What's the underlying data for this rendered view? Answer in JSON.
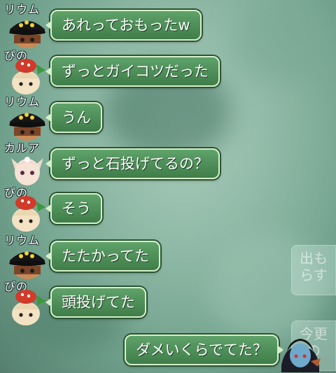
{
  "chat": {
    "messages": [
      {
        "speaker": "リウム",
        "text": "あれっておもったw"
      },
      {
        "speaker": "ぴの",
        "text": "ずっとガイコツだった"
      },
      {
        "speaker": "リウム",
        "text": "うん"
      },
      {
        "speaker": "カルア",
        "text": "ずっと石投げてるの？"
      },
      {
        "speaker": "ぴの",
        "text": "そう"
      },
      {
        "speaker": "リウム",
        "text": "たたかってた"
      },
      {
        "speaker": "ぴの",
        "text": "頭投げてた"
      }
    ],
    "my_message": {
      "text": "ダメいくらでてた？"
    }
  },
  "side_buttons": [
    {
      "label": "出も\nらす"
    },
    {
      "label": "今更\nの"
    }
  ]
}
